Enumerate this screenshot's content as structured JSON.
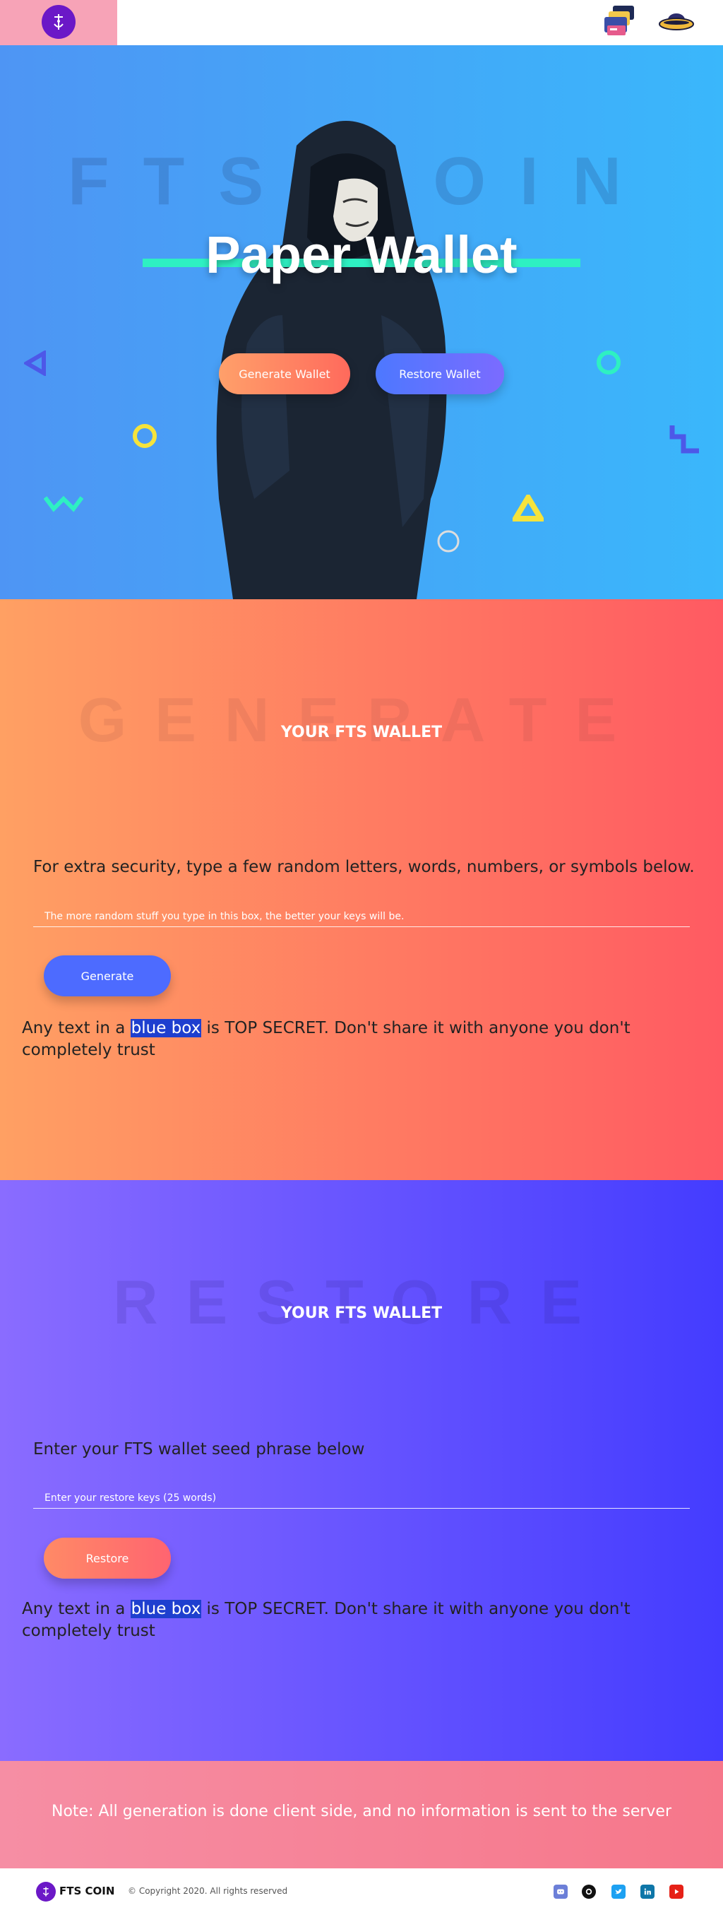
{
  "header": {
    "logo_alt": "FTS logo"
  },
  "hero": {
    "background_text": "FTS COIN",
    "title": "Paper Wallet",
    "generate_button": "Generate Wallet",
    "restore_button": "Restore Wallet"
  },
  "generate": {
    "background_text": "GENERATE",
    "title": "YOUR FTS WALLET",
    "description": "For extra security, type a few random letters, words, numbers, or symbols below.",
    "input_placeholder": "The more random stuff you type in this box, the better your keys will be.",
    "button": "Generate",
    "warning_before": "Any text in a ",
    "warning_highlight": "blue box",
    "warning_after": " is TOP SECRET. Don't share it with anyone you don't completely trust"
  },
  "restore": {
    "background_text": "RESTORE",
    "title": "YOUR FTS WALLET",
    "description": "Enter your FTS wallet seed phrase below",
    "input_placeholder": "Enter your restore keys (25 words)",
    "button": "Restore",
    "warning_before": "Any text in a ",
    "warning_highlight": "blue box",
    "warning_after": " is TOP SECRET. Don't share it with anyone you don't completely trust"
  },
  "note": {
    "text": "Note: All generation is done client side, and no information is sent to the server"
  },
  "footer": {
    "brand": "FTS COIN",
    "copyright": "© Copyright 2020. All rights reserved",
    "social": [
      "discord-icon",
      "github-icon",
      "twitter-icon",
      "linkedin-icon",
      "youtube-icon"
    ]
  },
  "colors": {
    "hero_start": "#4e95f4",
    "hero_end": "#3ab7fb",
    "generate_start": "#ffa063",
    "generate_end": "#ff5a62",
    "restore_start": "#8a6cff",
    "restore_end": "#443cff",
    "accent_teal": "#2ef0c2",
    "highlight_blue": "#1e3fcf",
    "brand_purple": "#6b18c7"
  }
}
